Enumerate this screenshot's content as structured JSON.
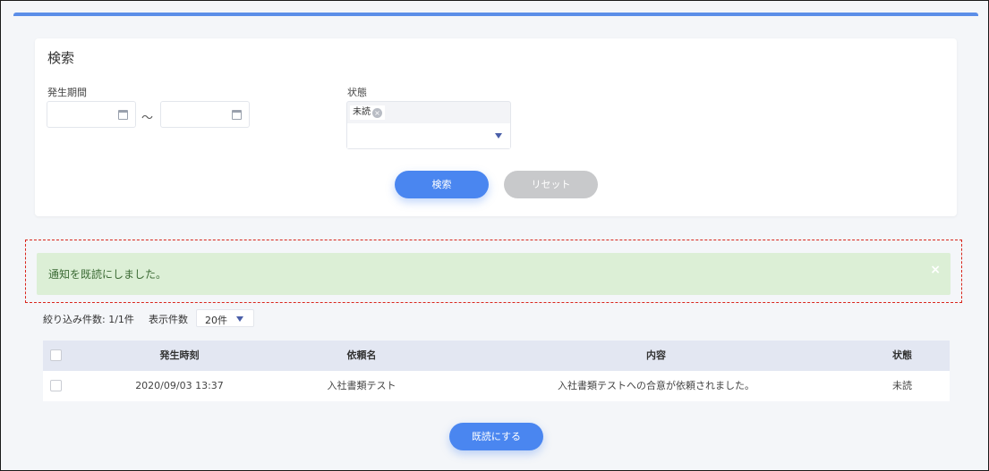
{
  "search": {
    "title": "検索",
    "period_label": "発生期間",
    "date_from": "",
    "date_to": "",
    "range_separator": "～",
    "status_label": "状態",
    "status_selected": [
      "未読"
    ],
    "search_button": "検索",
    "reset_button": "リセット"
  },
  "alert": {
    "message": "通知を既読にしました。",
    "close_symbol": "×"
  },
  "list_controls": {
    "filter_count_label": "絞り込み件数: 1/1件",
    "page_size_label": "表示件数",
    "page_size_value": "20件"
  },
  "table": {
    "headers": {
      "occurred_at": "発生時刻",
      "request_name": "依頼名",
      "content": "内容",
      "status": "状態"
    },
    "rows": [
      {
        "occurred_at": "2020/09/03 13:37",
        "request_name": "入社書類テスト",
        "content": "入社書類テストへの合意が依頼されました。",
        "status": "未読"
      }
    ]
  },
  "mark_read_button": "既読にする",
  "colors": {
    "primary": "#4a86f0",
    "alert_bg": "#dcefd6",
    "alert_text": "#3c6b35",
    "highlight_border": "#d9261c",
    "table_header_bg": "#e3e7f2"
  }
}
